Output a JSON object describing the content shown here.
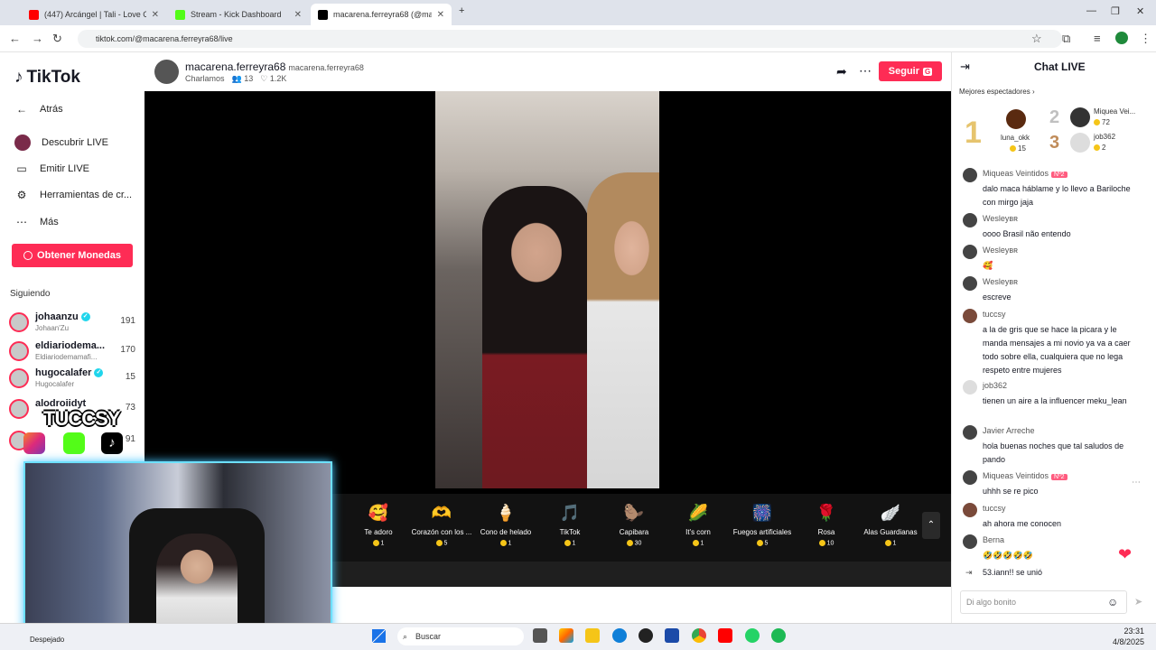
{
  "browser": {
    "tabs": [
      {
        "label": "(447) Arcángel | Tali - Love Cabr...",
        "color": "#ff0000"
      },
      {
        "label": "Stream - Kick Dashboard",
        "color": "#53fc18"
      },
      {
        "label": "macarena.ferreyra68 (@ma...",
        "color": "#000000"
      }
    ],
    "url": "tiktok.com/@macarena.ferreyra68/live"
  },
  "sidebar": {
    "brand": "TikTok",
    "nav": [
      {
        "label": "Atrás",
        "icon": "arrow-left-icon"
      },
      {
        "label": "Descubrir LIVE",
        "icon": "live-icon"
      },
      {
        "label": "Emitir LIVE",
        "icon": "camera-icon"
      },
      {
        "label": "Herramientas de cr...",
        "icon": "tools-icon"
      },
      {
        "label": "Más",
        "icon": "more-icon"
      }
    ],
    "coins_button": "Obtener Monedas",
    "following_title": "Siguiendo",
    "following": [
      {
        "name": "johaanzu",
        "sub": "Johaan'Zu",
        "count": "191",
        "verified": true
      },
      {
        "name": "eldiariodema...",
        "sub": "Eldiariodemamafi...",
        "count": "170",
        "verified": false
      },
      {
        "name": "hugocalafer",
        "sub": "Hugocalafer",
        "count": "15",
        "verified": true
      },
      {
        "name": "alodroiidyt",
        "sub": "",
        "count": "73",
        "verified": true
      },
      {
        "name": "",
        "sub": "",
        "count": "91",
        "verified": false
      }
    ]
  },
  "stream": {
    "host": "macarena.ferreyra68",
    "handle": "macarena.ferreyra68",
    "category": "Charlamos",
    "viewers": "13",
    "likes": "1.2K",
    "follow_label": "Seguir"
  },
  "gifts": [
    {
      "name": "Te adoro",
      "price": "1",
      "icon": "🥰"
    },
    {
      "name": "Corazón con los ...",
      "price": "5",
      "icon": "🫶"
    },
    {
      "name": "Cono de helado",
      "price": "1",
      "icon": "🍦"
    },
    {
      "name": "TikTok",
      "price": "1",
      "icon": "🎵"
    },
    {
      "name": "Capibara",
      "price": "30",
      "icon": "🦫"
    },
    {
      "name": "It's corn",
      "price": "1",
      "icon": "🌽"
    },
    {
      "name": "Fuegos artificiales",
      "price": "5",
      "icon": "🎆"
    },
    {
      "name": "Rosa",
      "price": "10",
      "icon": "🌹"
    },
    {
      "name": "Alas Guardianas",
      "price": "1",
      "icon": "🪽"
    }
  ],
  "overlay": {
    "streamer_tag": "TUCCSY"
  },
  "chat": {
    "title": "Chat LIVE",
    "top_label": "Mejores espectadores",
    "top_viewers": [
      {
        "rank": "1",
        "name": "luna_okk",
        "coins": "15"
      },
      {
        "rank": "2",
        "name": "Miquea Vei...",
        "coins": "72"
      },
      {
        "rank": "3",
        "name": "job362",
        "coins": "2"
      }
    ],
    "messages": [
      {
        "user": "Miqueas Veintidos",
        "badge": "Nº2",
        "text": "dalo maca háblame y lo llevo a Bariloche con mirgo jaja"
      },
      {
        "user": "Wesleyʙʀ",
        "badge": "",
        "text": "oooo Brasil não entendo"
      },
      {
        "user": "Wesleyʙʀ",
        "badge": "",
        "text": "🥰"
      },
      {
        "user": "Wesleyʙʀ",
        "badge": "",
        "text": "escreve"
      },
      {
        "user": "tuccsy",
        "badge": "",
        "text": "a la de gris que se hace la picara y le manda mensajes a mi novio ya va a caer todo sobre ella, cualquiera que no lega respeto entre mujeres"
      },
      {
        "user": "job362",
        "badge": "",
        "text": "tienen un aire a la influencer meku_lean"
      },
      {
        "user": "Javier Arreche",
        "badge": "",
        "text": "hola buenas noches que tal saludos de pando"
      },
      {
        "user": "Miqueas Veintidos",
        "badge": "Nº2",
        "text": "uhhh se re pico"
      },
      {
        "user": "tuccsy",
        "badge": "",
        "text": "ah ahora me conocen"
      },
      {
        "user": "Berna",
        "badge": "",
        "text": "🤣🤣🤣🤣🤣"
      },
      {
        "user": "",
        "badge": "",
        "text": "53.iann!! se unió"
      }
    ],
    "input_placeholder": "Di algo bonito"
  },
  "taskbar": {
    "search": "Buscar",
    "weather": "Despejado",
    "time": "23:31",
    "date": "4/8/2025"
  },
  "colors": {
    "accent": "#fe2c55",
    "verified": "#20d5ec",
    "coin": "#f5c518"
  }
}
